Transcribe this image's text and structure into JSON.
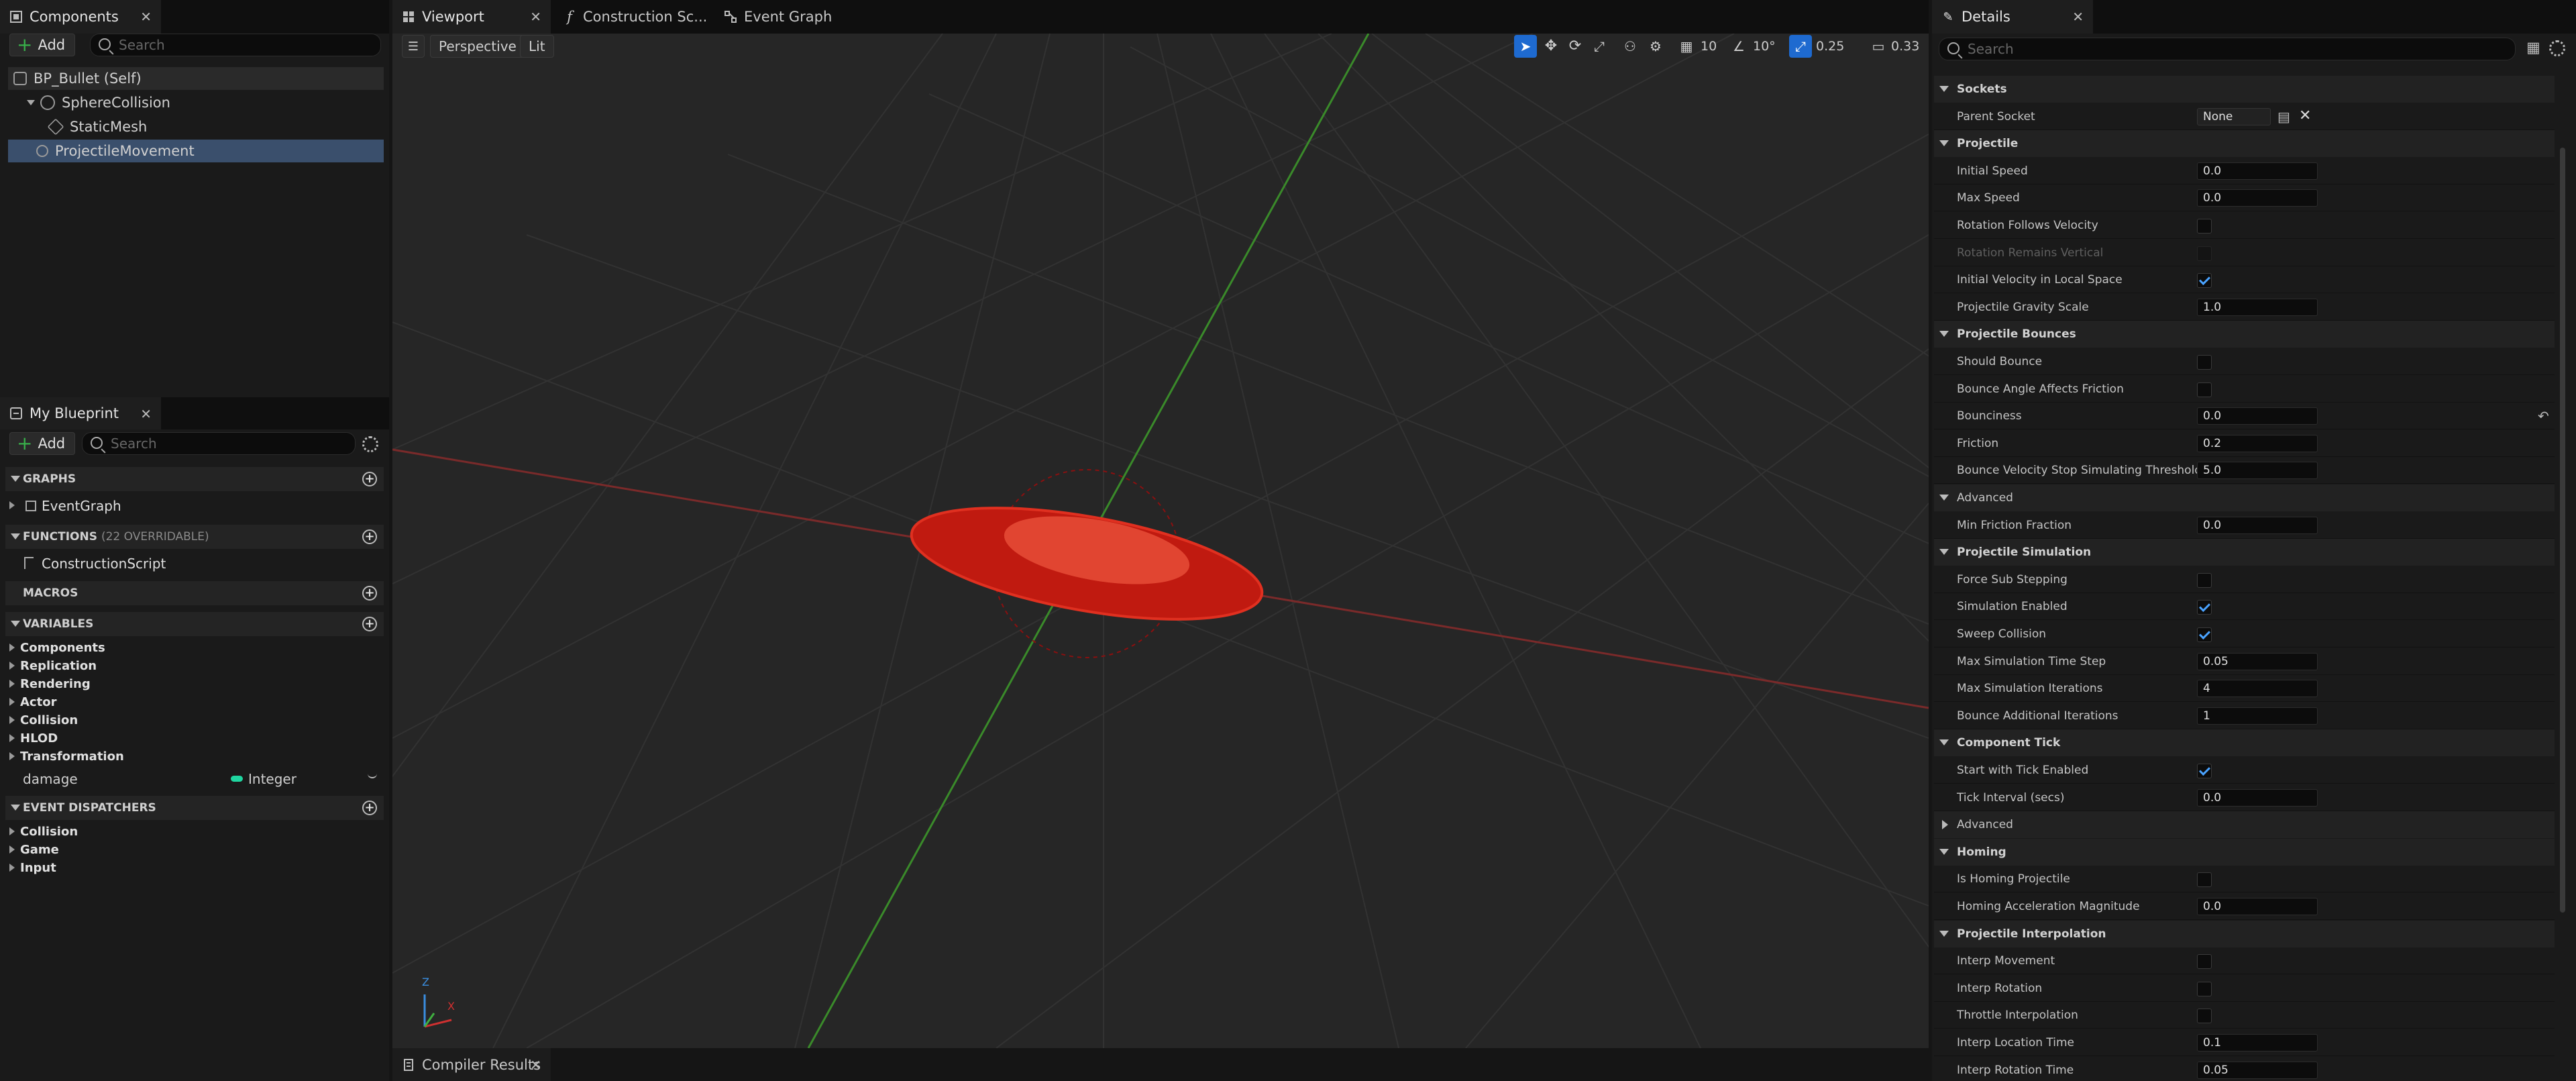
{
  "components_panel": {
    "tab_label": "Components",
    "add_label": "Add",
    "search_placeholder": "Search",
    "tree": [
      {
        "label": "BP_Bullet (Self)",
        "depth": 0
      },
      {
        "label": "SphereCollision",
        "depth": 1
      },
      {
        "label": "StaticMesh",
        "depth": 2
      },
      {
        "label": "ProjectileMovement",
        "depth": 1
      }
    ]
  },
  "my_blueprint": {
    "tab_label": "My Blueprint",
    "add_label": "Add",
    "search_placeholder": "Search",
    "graphs_label": "GRAPHS",
    "event_graph": "EventGraph",
    "functions_label": "FUNCTIONS",
    "functions_sub": "(22 OVERRIDABLE)",
    "construction_script": "ConstructionScript",
    "macros_label": "MACROS",
    "variables_label": "VARIABLES",
    "variable_categories": [
      "Components",
      "Replication",
      "Rendering",
      "Actor",
      "Collision",
      "HLOD",
      "Transformation"
    ],
    "variable": {
      "name": "damage",
      "type": "Integer",
      "type_color": "#1fd6a0"
    },
    "dispatchers_label": "EVENT DISPATCHERS",
    "dispatcher_categories": [
      "Collision",
      "Game",
      "Input"
    ]
  },
  "editor_tabs": [
    "Viewport",
    "Construction Sc...",
    "Event Graph"
  ],
  "viewport": {
    "view_mode": "Perspective",
    "lighting": "Lit",
    "grid_snap": "10",
    "rotation_snap": "10°",
    "scale_snap": "0.25",
    "camera_speed": "0.33",
    "axis_x": "X",
    "axis_z": "Z"
  },
  "bottom_tab": "Compiler Results",
  "details": {
    "tab_label": "Details",
    "search_placeholder": "Search",
    "rows": [
      {
        "kind": "section",
        "label": "Sockets"
      },
      {
        "kind": "value",
        "label": "Parent Socket",
        "value": "None",
        "socket": true
      },
      {
        "kind": "section",
        "label": "Projectile"
      },
      {
        "kind": "value",
        "label": "Initial Speed",
        "value": "0.0"
      },
      {
        "kind": "value",
        "label": "Max Speed",
        "value": "0.0"
      },
      {
        "kind": "check",
        "label": "Rotation Follows Velocity",
        "checked": false
      },
      {
        "kind": "check",
        "label": "Rotation Remains Vertical",
        "checked": false,
        "disabled": true
      },
      {
        "kind": "check",
        "label": "Initial Velocity in Local Space",
        "checked": true
      },
      {
        "kind": "value",
        "label": "Projectile Gravity Scale",
        "value": "1.0"
      },
      {
        "kind": "section",
        "label": "Projectile Bounces"
      },
      {
        "kind": "check",
        "label": "Should Bounce",
        "checked": false
      },
      {
        "kind": "check",
        "label": "Bounce Angle Affects Friction",
        "checked": false
      },
      {
        "kind": "value",
        "label": "Bounciness",
        "value": "0.0",
        "reset": true
      },
      {
        "kind": "value",
        "label": "Friction",
        "value": "0.2"
      },
      {
        "kind": "value",
        "label": "Bounce Velocity Stop Simulating Threshold",
        "value": "5.0"
      },
      {
        "kind": "advanced",
        "label": "Advanced",
        "open": true
      },
      {
        "kind": "value",
        "label": "Min Friction Fraction",
        "value": "0.0"
      },
      {
        "kind": "section",
        "label": "Projectile Simulation"
      },
      {
        "kind": "check",
        "label": "Force Sub Stepping",
        "checked": false
      },
      {
        "kind": "check",
        "label": "Simulation Enabled",
        "checked": true
      },
      {
        "kind": "check",
        "label": "Sweep Collision",
        "checked": true
      },
      {
        "kind": "value",
        "label": "Max Simulation Time Step",
        "value": "0.05"
      },
      {
        "kind": "value",
        "label": "Max Simulation Iterations",
        "value": "4"
      },
      {
        "kind": "value",
        "label": "Bounce Additional Iterations",
        "value": "1"
      },
      {
        "kind": "section",
        "label": "Component Tick"
      },
      {
        "kind": "check",
        "label": "Start with Tick Enabled",
        "checked": true
      },
      {
        "kind": "value",
        "label": "Tick Interval (secs)",
        "value": "0.0"
      },
      {
        "kind": "advanced",
        "label": "Advanced",
        "open": false
      },
      {
        "kind": "section",
        "label": "Homing"
      },
      {
        "kind": "check",
        "label": "Is Homing Projectile",
        "checked": false
      },
      {
        "kind": "value",
        "label": "Homing Acceleration Magnitude",
        "value": "0.0"
      },
      {
        "kind": "section",
        "label": "Projectile Interpolation"
      },
      {
        "kind": "check",
        "label": "Interp Movement",
        "checked": false
      },
      {
        "kind": "check",
        "label": "Interp Rotation",
        "checked": false
      },
      {
        "kind": "check",
        "label": "Throttle Interpolation",
        "checked": false
      },
      {
        "kind": "value",
        "label": "Interp Location Time",
        "value": "0.1"
      },
      {
        "kind": "value",
        "label": "Interp Rotation Time",
        "value": "0.05"
      }
    ]
  }
}
